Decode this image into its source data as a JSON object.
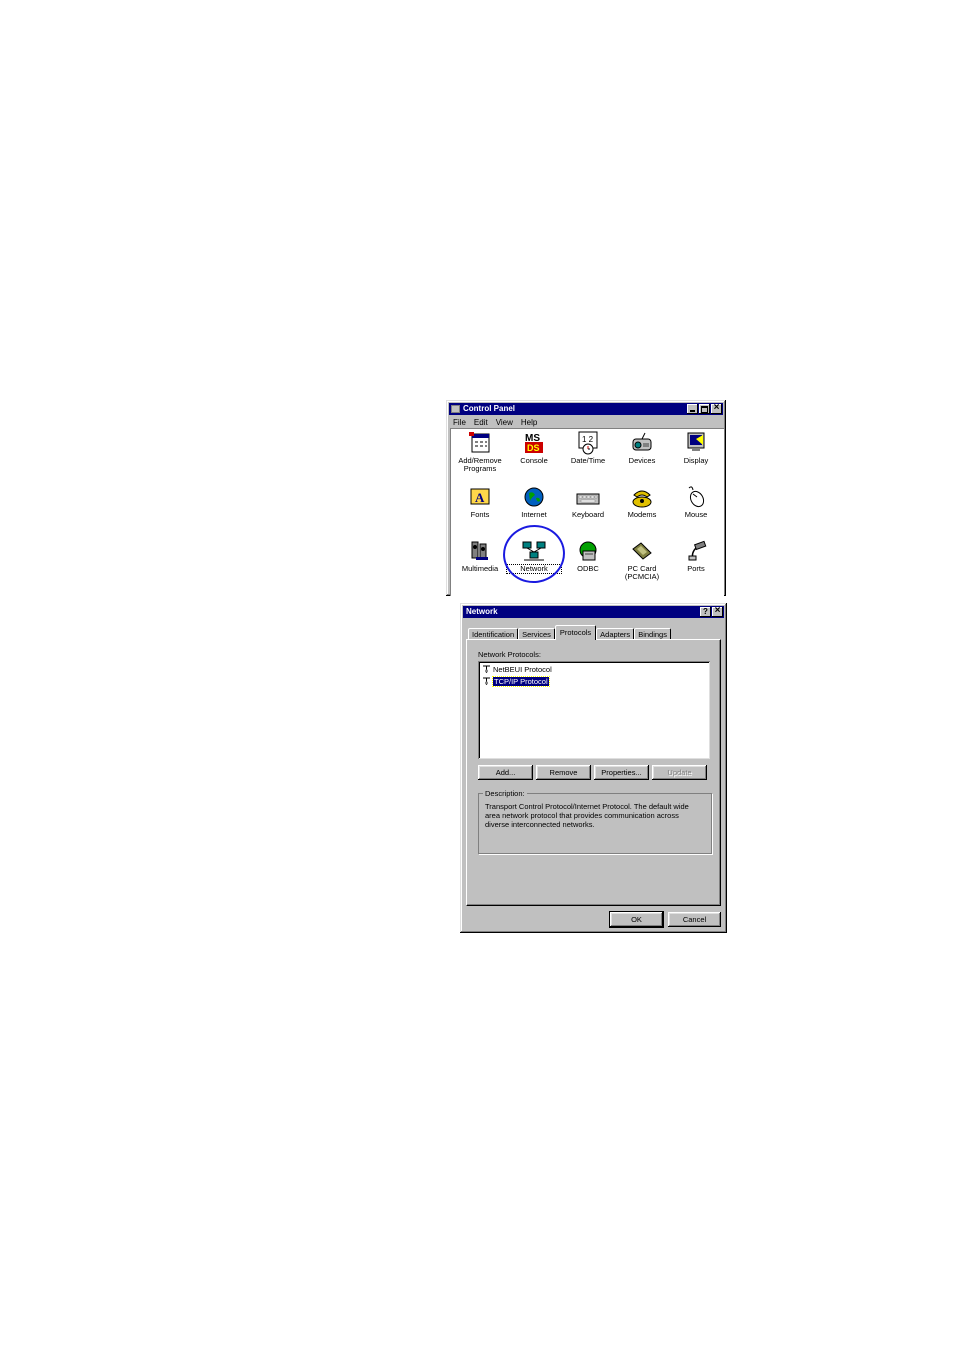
{
  "control_panel": {
    "title": "Control Panel",
    "menu": [
      "File",
      "Edit",
      "View",
      "Help"
    ],
    "items": [
      {
        "label": "Add/Remove Programs",
        "icon": "add-remove-programs-icon"
      },
      {
        "label": "Console",
        "icon": "ms-dos-console-icon"
      },
      {
        "label": "Date/Time",
        "icon": "calendar-clock-icon"
      },
      {
        "label": "Devices",
        "icon": "devices-icon"
      },
      {
        "label": "Display",
        "icon": "display-monitor-icon"
      },
      {
        "label": "Fonts",
        "icon": "fonts-folder-icon"
      },
      {
        "label": "Internet",
        "icon": "globe-internet-icon"
      },
      {
        "label": "Keyboard",
        "icon": "keyboard-icon"
      },
      {
        "label": "Modems",
        "icon": "modem-phone-icon"
      },
      {
        "label": "Mouse",
        "icon": "mouse-icon"
      },
      {
        "label": "Multimedia",
        "icon": "multimedia-icon"
      },
      {
        "label": "Network",
        "icon": "network-computers-icon"
      },
      {
        "label": "ODBC",
        "icon": "odbc-database-icon"
      },
      {
        "label": "PC Card (PCMCIA)",
        "icon": "pc-card-icon"
      },
      {
        "label": "Ports",
        "icon": "ports-plug-icon"
      }
    ],
    "annotation_color": "#1a1ae0"
  },
  "network_dialog": {
    "title": "Network",
    "help_label": "?",
    "tabs": [
      "Identification",
      "Services",
      "Protocols",
      "Adapters",
      "Bindings"
    ],
    "active_tab": "Protocols",
    "list_label": "Network Protocols:",
    "protocols": [
      "NetBEUI Protocol",
      "TCP/IP Protocol"
    ],
    "selected_protocol": "TCP/IP Protocol",
    "buttons": {
      "add": "Add...",
      "remove": "Remove",
      "properties": "Properties...",
      "update": "Update"
    },
    "description_label": "Description:",
    "description_text": "Transport Control Protocol/Internet Protocol. The default wide area network protocol that provides communication across diverse interconnected networks.",
    "ok": "OK",
    "cancel": "Cancel"
  }
}
